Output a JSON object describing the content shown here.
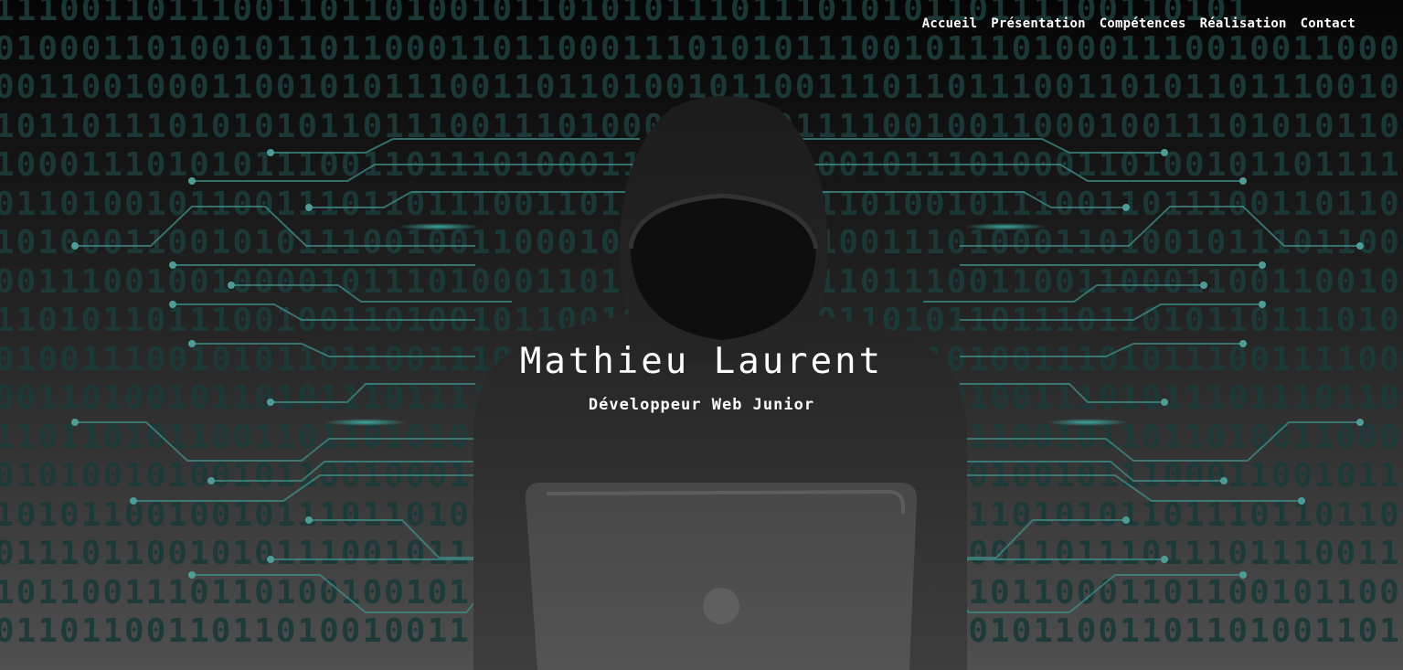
{
  "nav": {
    "items": [
      {
        "label": "Accueil"
      },
      {
        "label": "Présentation"
      },
      {
        "label": "Compétences"
      },
      {
        "label": "Réalisation"
      },
      {
        "label": "Contact"
      }
    ]
  },
  "hero": {
    "title": "Mathieu Laurent",
    "subtitle": "Développeur Web Junior"
  },
  "background": {
    "binary_rows": [
      "1110011011100110110100101101010111011101010110111100110101",
      "0100011010010110110001101100011101010111001011101000111001001100001",
      "0011001000110010101110011011010010110011101101110011010110111001001101",
      "1011011101010101101110011101000110100111100100110001001110101011011",
      "1000111010101110011011101000111001011000101110100011010010110111101",
      "0110100101100111011011100110101101100111010010111001101110011011011",
      "1010001100101011100100110001001101011110011101000110100101110110011",
      "0011100100100001011101000110101100111011011100110011000110011001011",
      "1101011011100100110100101100101011000101101011011101101011011101011",
      "0100111001010110110011101101100101111001011101001110101110011110010",
      "0011010010110101110111101110001101101110110101001110101110111011011",
      "1101101011001101101010110011100101011110110101100101101101001100011",
      "0101001010010110010001101101010011011100100010100101110001100101101",
      "1010110010010111011010010101101011001101001101101010110111011011001",
      "0111011001010111001011101100111001011011010010011011101110111001101",
      "1011001110110100100101110010011001110110110011011000110110010110011",
      "0110110011011010010011101101011001001110110100101100110110100110111"
    ]
  },
  "colors": {
    "binary": "#1c3a39",
    "circuit": "#3f8e89",
    "text": "#ffffff"
  },
  "icons": {
    "hacker": "hooded-figure-with-laptop-illustration"
  }
}
